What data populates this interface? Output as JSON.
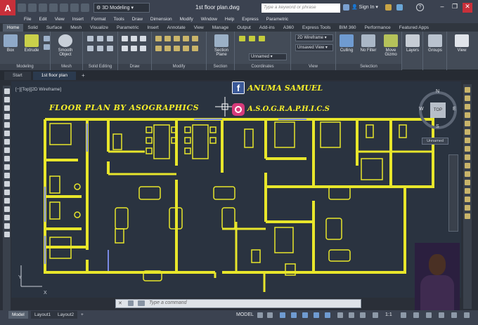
{
  "titlebar": {
    "app_letter": "A",
    "workspace": "3D Modeling",
    "doc_title": "1st floor plan.dwg",
    "search_placeholder": "Type a keyword or phrase",
    "signin": "Sign In",
    "help": "?"
  },
  "menus": [
    "File",
    "Edit",
    "View",
    "Insert",
    "Format",
    "Tools",
    "Draw",
    "Dimension",
    "Modify",
    "Window",
    "Help",
    "Express",
    "Parametric"
  ],
  "ribbon_tabs": [
    "Home",
    "Solid",
    "Surface",
    "Mesh",
    "Visualize",
    "Parametric",
    "Insert",
    "Annotate",
    "View",
    "Manage",
    "Output",
    "Add-ins",
    "A360",
    "Express Tools",
    "BIM 360",
    "Performance",
    "Featured Apps"
  ],
  "ribbon": {
    "box": "Box",
    "extrude": "Extrude",
    "smooth_object": "Smooth Object",
    "section_plane": "Section Plane",
    "culling": "Culling",
    "no_filter": "No Filter",
    "move_gizmo": "Move Gizmo",
    "layers": "Layers",
    "groups": "Groups",
    "view": "View",
    "visual_style": "2D Wireframe",
    "saved_view": "Unsaved View",
    "ucs": "Unnamed",
    "panels": {
      "modeling": "Modeling",
      "mesh": "Mesh",
      "solid_editing": "Solid Editing",
      "draw": "Draw",
      "modify": "Modify",
      "section": "Section",
      "coordinates": "Coordinates",
      "view": "View",
      "selection": "Selection"
    }
  },
  "doc_tabs": {
    "start": "Start",
    "current": "1st floor plan",
    "plus": "+"
  },
  "viewport": {
    "label": "[−][Top][2D Wireframe]",
    "viewcube_top": "TOP",
    "compass": {
      "n": "N",
      "s": "S",
      "e": "E",
      "w": "W"
    },
    "ucs_name": "Unnamed",
    "axis_x": "X",
    "axis_y": "Y"
  },
  "drawing": {
    "heading": "FLOOR PLAN BY ASOGRAPHICS",
    "facebook_name": "ANUMA SAMUEL",
    "instagram_name": "A.S.O.G.R.A.P.H.I.C.S",
    "fb_letter": "f"
  },
  "command": {
    "placeholder": "Type a command",
    "close": "✕"
  },
  "status": {
    "layouts": [
      "Model",
      "Layout1",
      "Layout2"
    ],
    "layout_plus": "+",
    "model": "MODEL",
    "scale": "1:1"
  },
  "colors": {
    "accent": "#f5ee2a",
    "wall": "#e8e62b",
    "window": "#7a8ae6",
    "autocad_red": "#c8303a"
  }
}
